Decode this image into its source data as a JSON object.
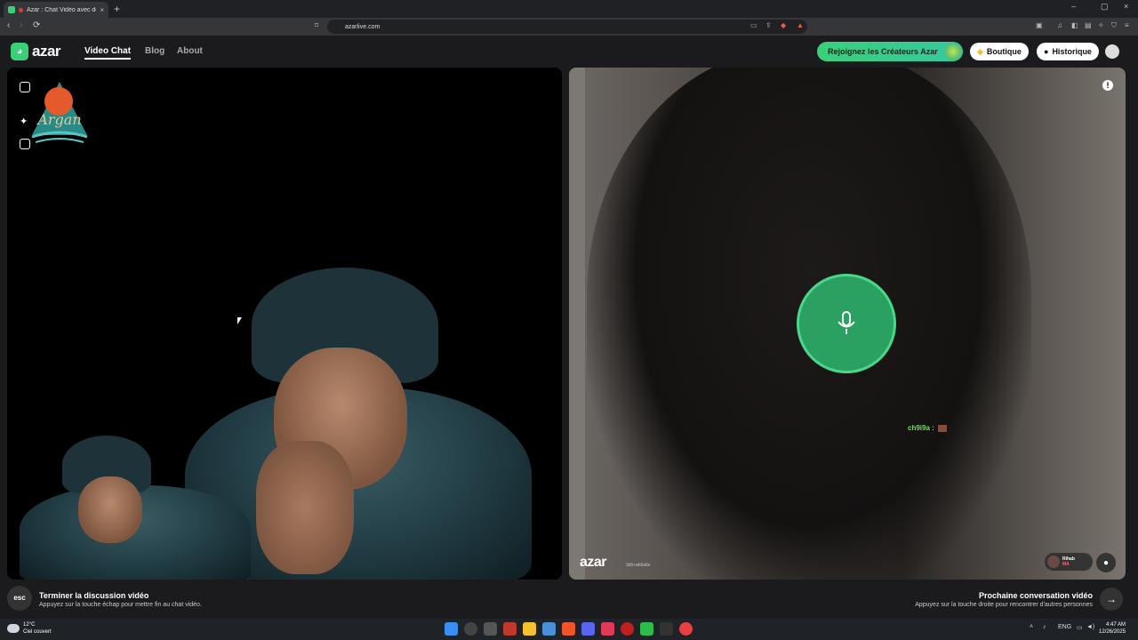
{
  "browser": {
    "tab_title": "Azar : Chat Vidéo avec de no",
    "tab_close": "×",
    "new_tab": "+",
    "url": "azarlive.com",
    "window_controls": [
      "–",
      "▢",
      "×"
    ]
  },
  "header": {
    "logo_text": "azar",
    "nav": [
      "Video Chat",
      "Blog",
      "About"
    ],
    "creators_button": "Rejoignez les Créateurs Azar",
    "shop_button": "Boutique",
    "history_button": "Historique"
  },
  "remote": {
    "chat_name": "ch9i9a :",
    "watermark": "azar",
    "watermark_id": "3x6+ah6a6x",
    "user_name": "Rihab",
    "user_country": "MA",
    "report_icon": "!"
  },
  "bottom": {
    "esc_label": "esc",
    "end_title": "Terminer la discussion vidéo",
    "end_sub": "Appuyez sur la touche échap pour mettre fin au chat vidéo.",
    "next_title": "Prochaine conversation vidéo",
    "next_sub": "Appuyez sur la touche droite pour rencontrer d'autres personnes",
    "next_arrow": "→"
  },
  "taskbar": {
    "temp": "12°C",
    "weather": "Ciel couvert",
    "lang": "ENG",
    "time": "4:47 AM",
    "date": "12/26/2025"
  },
  "colors": {
    "accent": "#3ad07a",
    "bg": "#1b1b1d"
  }
}
